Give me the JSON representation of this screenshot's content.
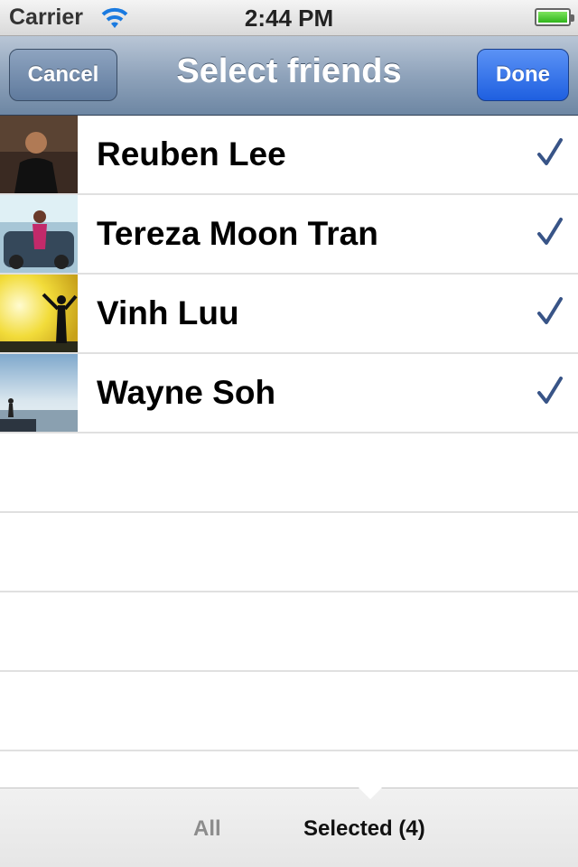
{
  "status_bar": {
    "carrier": "Carrier",
    "time": "2:44 PM",
    "battery_level": 1.0
  },
  "nav": {
    "title": "Select friends",
    "cancel_label": "Cancel",
    "done_label": "Done"
  },
  "friends": [
    {
      "name": "Reuben Lee",
      "selected": true,
      "avatar_icon": "photo-person-dark-bg"
    },
    {
      "name": "Tereza Moon Tran",
      "selected": true,
      "avatar_icon": "photo-person-car"
    },
    {
      "name": "Vinh Luu",
      "selected": true,
      "avatar_icon": "photo-silhouette-yellow-sky"
    },
    {
      "name": "Wayne Soh",
      "selected": true,
      "avatar_icon": "photo-silhouette-sea"
    }
  ],
  "bottom_tabs": {
    "all_label": "All",
    "selected_label": "Selected (4)",
    "active": "selected"
  },
  "colors": {
    "nav_bar": "#8fa3bb",
    "done_button": "#1e5fe0",
    "checkmark": "#385487"
  }
}
